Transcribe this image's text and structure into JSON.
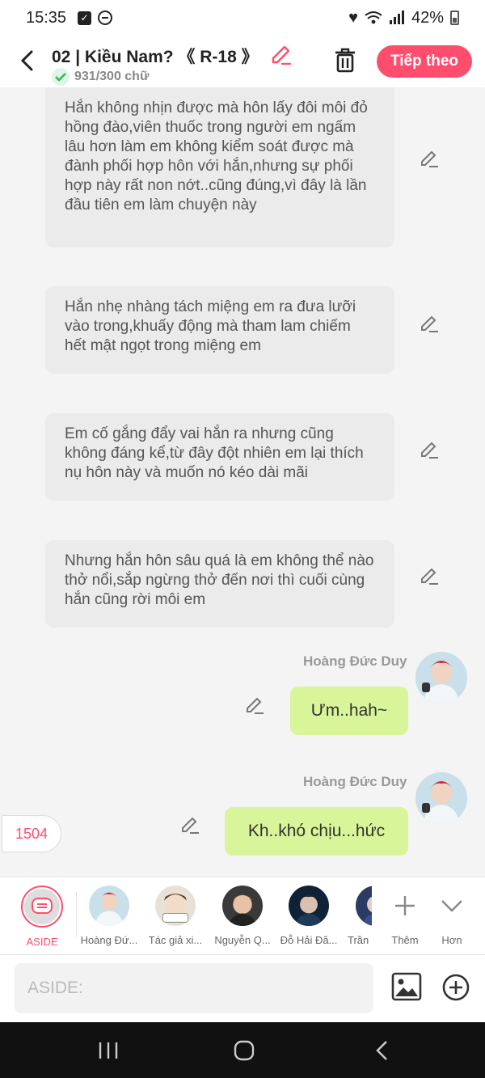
{
  "status_bar": {
    "time": "15:35",
    "battery": "42%",
    "icons": [
      "checkbox-icon",
      "dnd-icon",
      "heart-icon",
      "wifi-icon",
      "signal-icon",
      "battery-icon"
    ]
  },
  "header": {
    "title": "02 | Kiều Nam? 《 R-18 》",
    "word_count": "931/300 chữ",
    "next_button": "Tiếp theo"
  },
  "narrations": [
    {
      "text": "Hắn không nhịn được mà hôn lấy đôi môi đỏ hồng đào,viên thuốc trong người em ngấm lâu hơn làm em không kiểm soát được mà đành phối hợp hôn với hắn,nhưng sự phối hợp này rất non nớt..cũng đúng,vì đây là lần đầu tiên em làm chuyện này"
    },
    {
      "text": "Hắn nhẹ nhàng tách miệng em ra đưa lưỡi vào trong,khuấy động mà tham lam chiếm hết mật ngọt trong miệng em"
    },
    {
      "text": "Em cố gắng đẩy vai hắn ra nhưng cũng không đáng kể,từ đây đột nhiên em lại thích nụ hôn này và muốn nó kéo dài mãi"
    },
    {
      "text": "Nhưng hắn hôn sâu quá là em không thể nào thở nổi,sắp ngừng thở đến nơi thì cuối cùng hắn cũng rời môi em"
    }
  ],
  "messages": [
    {
      "sender": "Hoàng Đức Duy",
      "text": "Ưm..hah~"
    },
    {
      "sender": "Hoàng Đức Duy",
      "text": "Kh..khó chịu...hức"
    }
  ],
  "count_badge": "1504",
  "characters": [
    {
      "label": "ASIDE"
    },
    {
      "label": "Hoàng Đứ..."
    },
    {
      "label": "Tác giả xi..."
    },
    {
      "label": "Nguyễn Q..."
    },
    {
      "label": "Đỗ Hải Đă..."
    },
    {
      "label": "Trần"
    }
  ],
  "char_actions": {
    "more": "Thêm",
    "expand": "Hơn"
  },
  "input": {
    "placeholder": "ASIDE:"
  },
  "colors": {
    "accent": "#ff4d6d",
    "bubble": "#d9f59a",
    "narration_bg": "#ebebeb"
  }
}
